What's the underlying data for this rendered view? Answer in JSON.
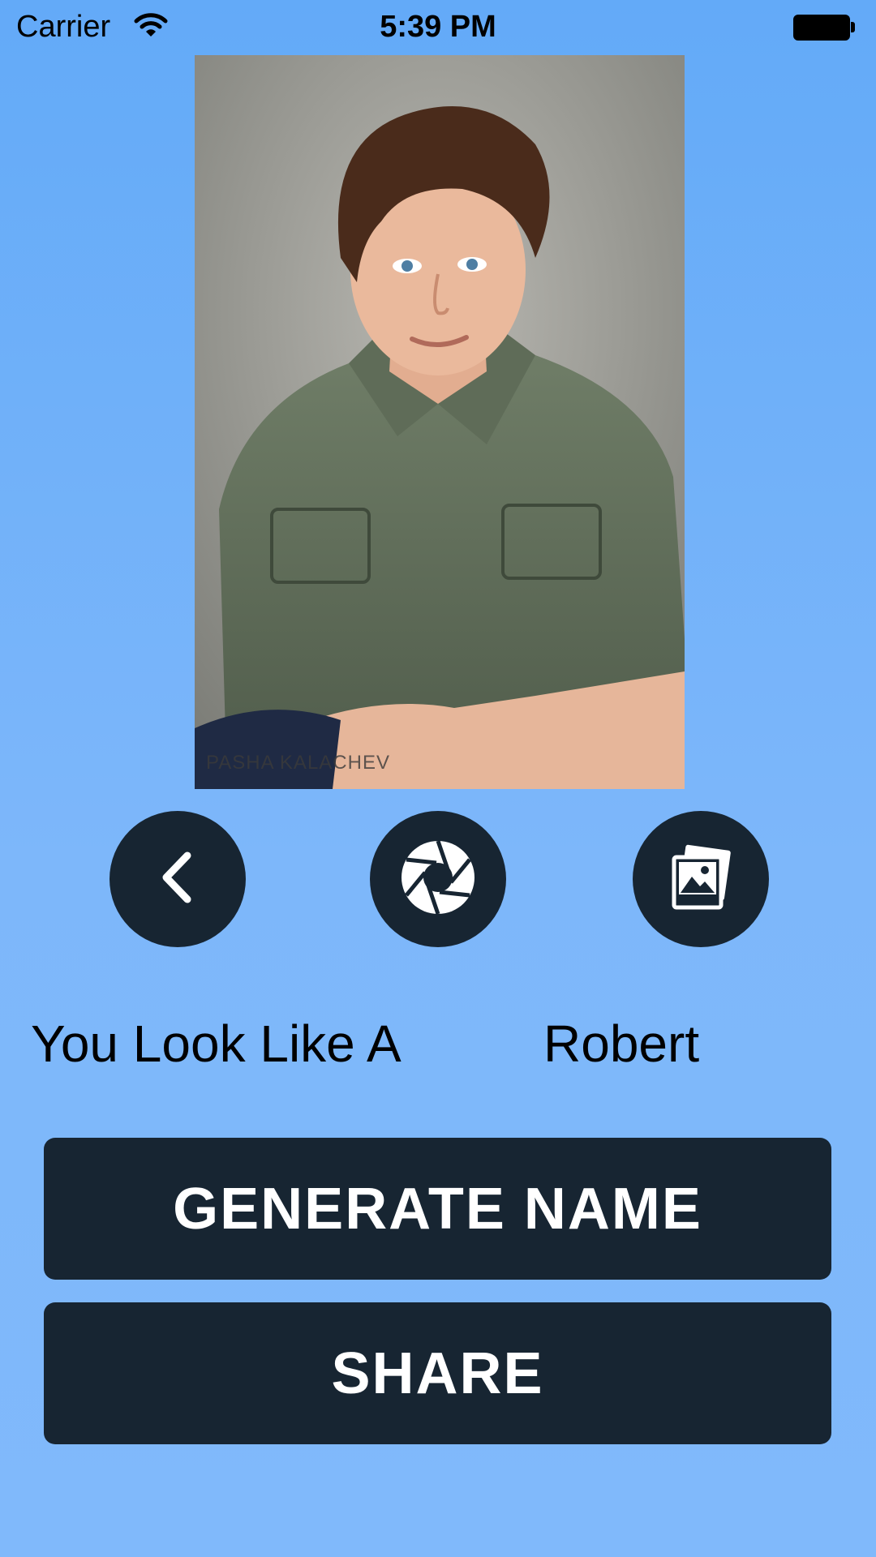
{
  "status_bar": {
    "carrier": "Carrier",
    "time": "5:39 PM",
    "icons": [
      "wifi-icon",
      "battery-icon"
    ]
  },
  "photo": {
    "watermark": "PASHA KALACHEV"
  },
  "controls": {
    "back_icon": "chevron-left-icon",
    "camera_icon": "camera-shutter-icon",
    "gallery_icon": "photo-gallery-icon"
  },
  "result": {
    "label": "You Look Like A",
    "name": "Robert"
  },
  "actions": {
    "generate_label": "GENERATE NAME",
    "share_label": "SHARE"
  },
  "colors": {
    "background": "#7db7fa",
    "button": "#172532",
    "button_text": "#ffffff"
  }
}
